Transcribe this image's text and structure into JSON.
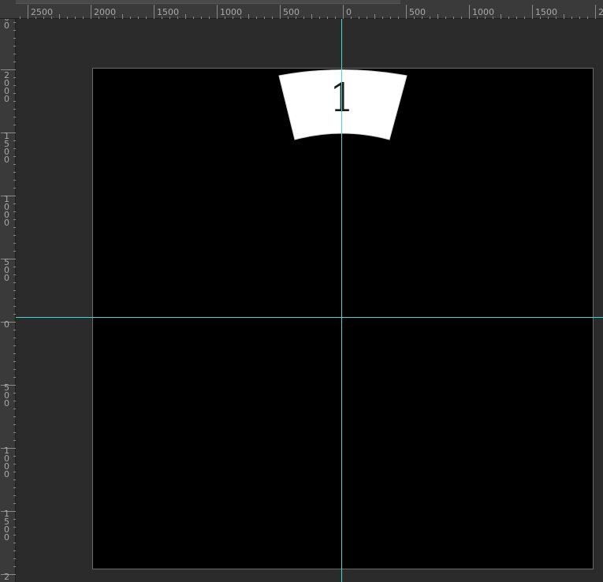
{
  "rulers": {
    "top_labels": [
      "2500",
      "2000",
      "1500",
      "1000",
      "500",
      "0",
      "500",
      "1000",
      "1500",
      "2"
    ],
    "left_labels": [
      "500",
      "2000",
      "1500",
      "1000",
      "500",
      "0",
      "500",
      "1000",
      "1500",
      "2"
    ]
  },
  "document": {
    "shape_label": "1"
  },
  "colors": {
    "guide": "#44d6d6",
    "document_background": "#000000",
    "shape_fill": "#ffffff",
    "workspace": "#2b2b2b",
    "ruler_background": "#3a3a3a",
    "ruler_text": "#a8a8a8"
  }
}
